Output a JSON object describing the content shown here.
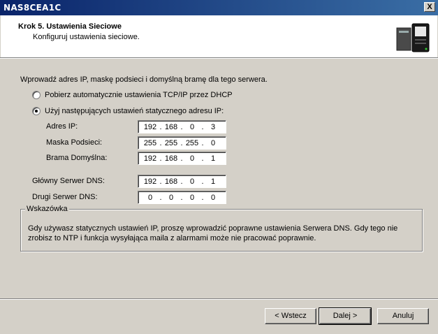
{
  "window": {
    "title": "NAS8CEA1C",
    "close_label": "X"
  },
  "header": {
    "step_title": "Krok 5. Ustawienia Sieciowe",
    "step_subtitle": "Konfiguruj ustawienia sieciowe."
  },
  "intro": "Wprowadź adres IP, maskę podsieci i domyślną bramę dla tego serwera.",
  "options": {
    "dhcp_label": "Pobierz automatycznie ustawienia TCP/IP przez DHCP",
    "static_label": "Użyj następujących ustawień statycznego adresu IP:",
    "selected": "static"
  },
  "fields": {
    "ip": {
      "label": "Adres IP:",
      "octets": [
        "192",
        "168",
        "0",
        "3"
      ]
    },
    "mask": {
      "label": "Maska Podsieci:",
      "octets": [
        "255",
        "255",
        "255",
        "0"
      ]
    },
    "gateway": {
      "label": "Brama Domyślna:",
      "octets": [
        "192",
        "168",
        "0",
        "1"
      ]
    },
    "dns1": {
      "label": "Główny Serwer DNS:",
      "octets": [
        "192",
        "168",
        "0",
        "1"
      ]
    },
    "dns2": {
      "label": "Drugi Serwer DNS:",
      "octets": [
        "0",
        "0",
        "0",
        "0"
      ]
    }
  },
  "hint": {
    "legend": "Wskazówka",
    "text": "Gdy używasz statycznych ustawień IP, proszę wprowadzić poprawne ustawienia Serwera DNS. Gdy tego nie zrobisz to NTP i funkcja wysyłająca maila z alarmami może nie pracować poprawnie."
  },
  "buttons": {
    "back": "< Wstecz",
    "next": "Dalej >",
    "cancel": "Anuluj"
  },
  "icons": {
    "header_icon": "nas-server-icon",
    "close": "close-icon"
  }
}
